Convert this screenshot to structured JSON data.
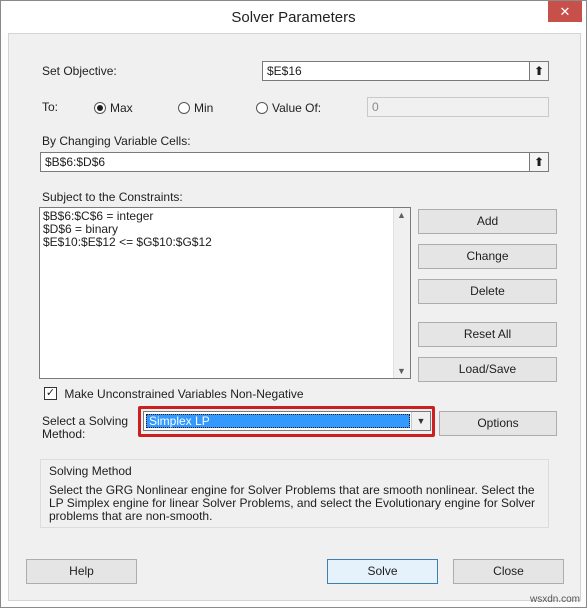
{
  "window": {
    "title": "Solver Parameters",
    "close_glyph": "✕"
  },
  "objective": {
    "label": "Set Objective:",
    "value": "$E$16"
  },
  "to": {
    "label": "To:",
    "options": [
      {
        "label": "Max",
        "selected": true
      },
      {
        "label": "Min",
        "selected": false
      },
      {
        "label": "Value Of:",
        "selected": false
      }
    ],
    "value_of": "0"
  },
  "changing": {
    "label": "By Changing Variable Cells:",
    "value": "$B$6:$D$6"
  },
  "constraints": {
    "label": "Subject to the Constraints:",
    "items": [
      "$B$6:$C$6 = integer",
      "$D$6 = binary",
      "$E$10:$E$12 <= $G$10:$G$12"
    ]
  },
  "constraint_buttons": {
    "add": "Add",
    "change": "Change",
    "delete": "Delete",
    "reset_all": "Reset All",
    "load_save": "Load/Save"
  },
  "nonnegative": {
    "label": "Make Unconstrained Variables Non-Negative",
    "checked": true
  },
  "method": {
    "label_line1": "Select a Solving",
    "label_line2": "Method:",
    "selected": "Simplex LP",
    "options_button": "Options"
  },
  "solving_method": {
    "title": "Solving Method",
    "description": "Select the GRG Nonlinear engine for Solver Problems that are smooth nonlinear. Select the LP Simplex engine for linear Solver Problems, and select the Evolutionary engine for Solver problems that are non-smooth."
  },
  "footer": {
    "help": "Help",
    "solve": "Solve",
    "close": "Close"
  },
  "watermark": "wsxdn.com",
  "colors": {
    "highlight": "#cc1f1f",
    "selection": "#3399ff",
    "close_button": "#c7504b"
  }
}
